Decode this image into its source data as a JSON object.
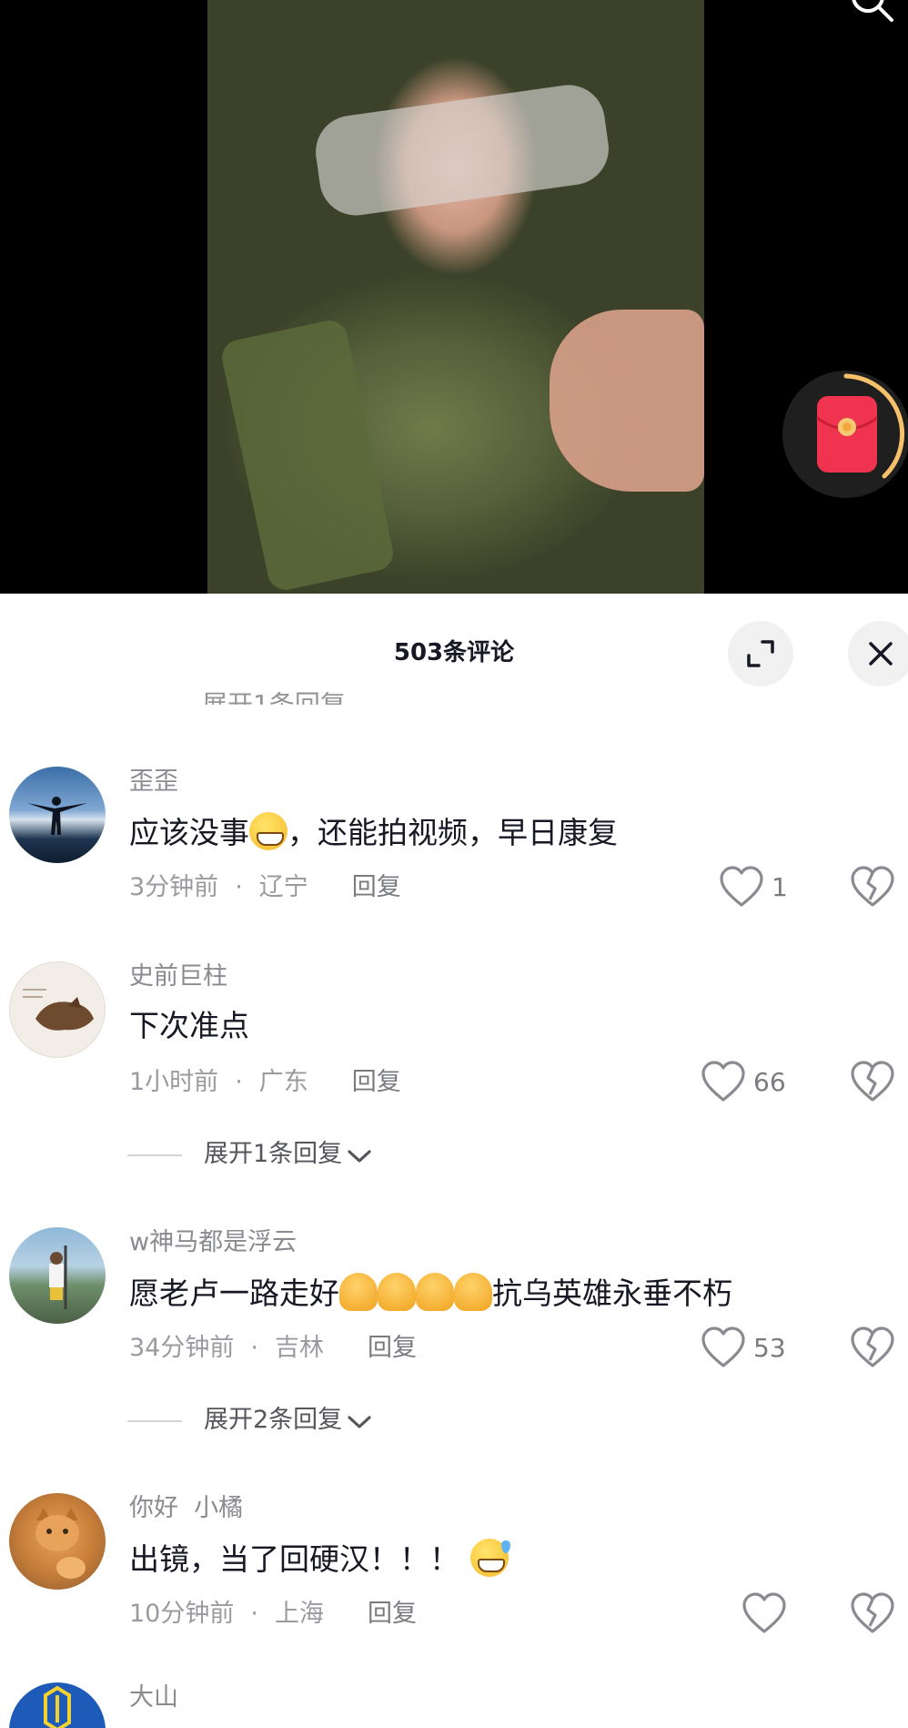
{
  "sheet": {
    "comment_count": "503条评论",
    "hidden_reply_peek": "展开1条回复"
  },
  "comments": [
    {
      "user": "歪歪",
      "text_before": "应该没事",
      "emoji": "grin",
      "text_after": "，还能拍视频，早日康复",
      "time": "3分钟前",
      "region": "辽宁",
      "reply": "回复",
      "likes": "1"
    },
    {
      "user": "史前巨柱",
      "text_before": "下次准点",
      "emoji": "",
      "text_after": "",
      "time": "1小时前",
      "region": "广东",
      "reply": "回复",
      "likes": "66"
    },
    {
      "user": "w神马都是浮云",
      "text_before": "愿老卢一路走好",
      "emoji": "pray-x4",
      "text_after": "抗乌英雄永垂不朽",
      "time": "34分钟前",
      "region": "吉林",
      "reply": "回复",
      "likes": "53"
    },
    {
      "user": "你好  小橘",
      "text_before": "出镜，当了回硬汉！！！",
      "emoji": "sweat",
      "text_after": "",
      "time": "10分钟前",
      "region": "上海",
      "reply": "回复",
      "likes": ""
    },
    {
      "user": "大山"
    }
  ],
  "expand_rows": [
    {
      "label": "展开1条回复"
    },
    {
      "label": "展开2条回复"
    }
  ],
  "icons": {
    "search": "search-icon",
    "red_packet": "red-packet-icon",
    "expand": "expand-icon",
    "close": "close-icon",
    "like": "heart-icon",
    "dislike": "broken-heart-icon",
    "chevron": "chevron-down-icon"
  },
  "colors": {
    "red_packet": "#f0344f",
    "ring": "#f5c26b",
    "text_primary": "#161823",
    "text_secondary": "#8a8b91"
  }
}
